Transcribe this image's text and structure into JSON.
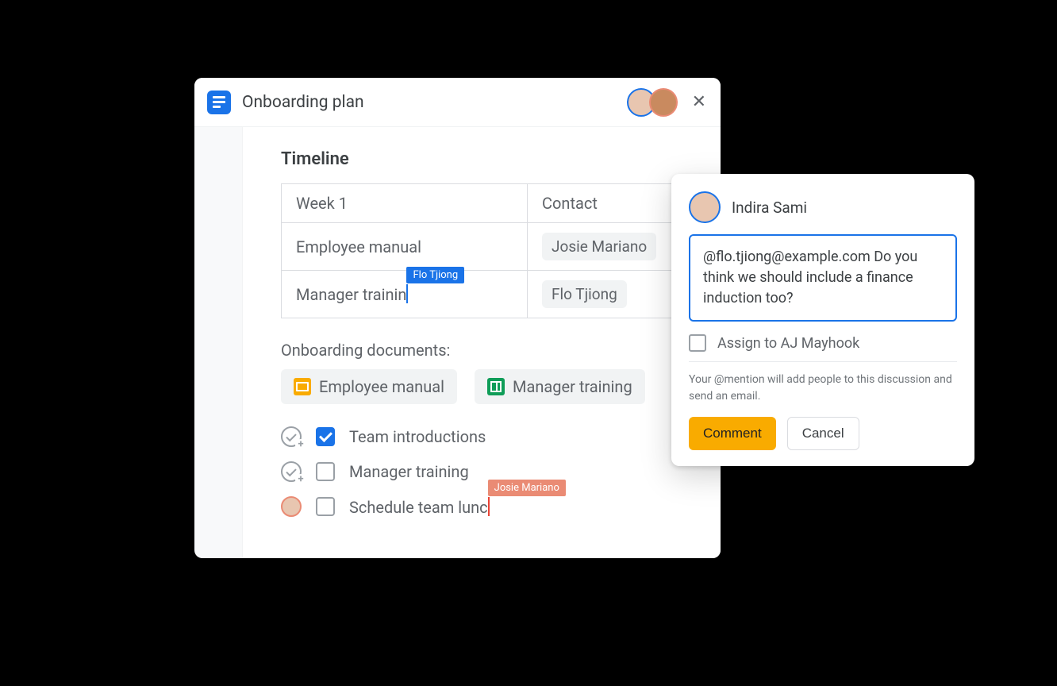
{
  "doc": {
    "title": "Onboarding plan",
    "collaborators": [
      "Indira Sami",
      "AJ Mayhook"
    ]
  },
  "section_heading": "Timeline",
  "table": {
    "headers": [
      "Week 1",
      "Contact"
    ],
    "rows": [
      {
        "task": "Employee manual",
        "contact": "Josie Mariano"
      },
      {
        "task": "Manager trainin",
        "contact": "Flo Tjiong",
        "editing_user": "Flo Tjiong",
        "cursor_color": "blue"
      }
    ]
  },
  "docs_label": "Onboarding documents:",
  "doc_chips": [
    {
      "icon": "slides",
      "label": "Employee manual"
    },
    {
      "icon": "sheets",
      "label": "Manager training"
    }
  ],
  "checklist": [
    {
      "kind": "assign",
      "checked": true,
      "label": "Team introductions"
    },
    {
      "kind": "assign",
      "checked": false,
      "label": "Manager training"
    },
    {
      "kind": "avatar",
      "checked": false,
      "label": "Schedule team lunc",
      "editing_user": "Josie Mariano",
      "cursor_color": "red"
    }
  ],
  "comment": {
    "author": "Indira Sami",
    "text": "@flo.tjiong@example.com Do you think we should include a finance induction too?",
    "assign_label": "Assign to AJ Mayhook",
    "hint": "Your @mention will add people to this discussion and send an email.",
    "primary": "Comment",
    "secondary": "Cancel"
  }
}
